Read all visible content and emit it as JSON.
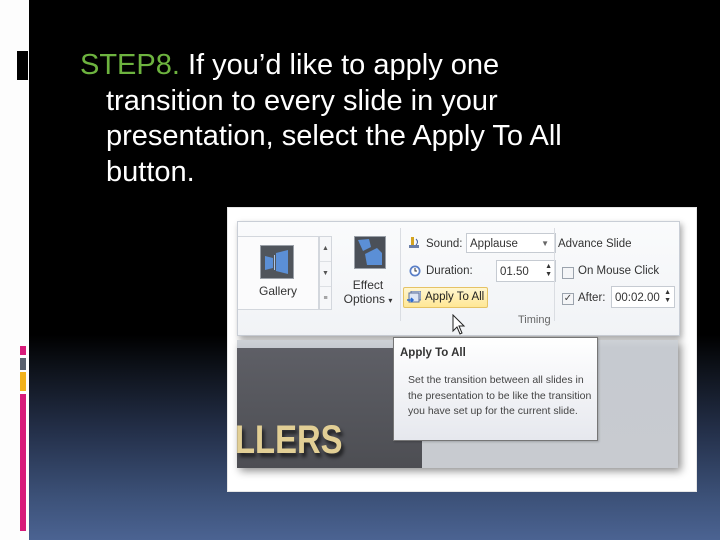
{
  "slide": {
    "title_step": "STEP8.",
    "title_lines": [
      "If you’d like to apply one",
      "transition to every slide in your",
      "presentation, select the Apply To All",
      "button."
    ],
    "accent_colors": {
      "step_text": "#6db33f",
      "magenta": "#d81b7a",
      "slate": "#59606e",
      "amber": "#f2b21b"
    }
  },
  "ribbon": {
    "gallery": {
      "label": "Gallery",
      "icon": "transition-gallery-icon"
    },
    "effect_options": {
      "label_line1": "Effect",
      "label_line2": "Options",
      "dropdown": "▾"
    },
    "sound": {
      "label": "Sound:",
      "value": "Applause",
      "icon": "speaker-icon"
    },
    "duration": {
      "label": "Duration:",
      "value": "01.50",
      "icon": "clock-icon"
    },
    "apply_to_all": {
      "label": "Apply To All",
      "icon": "apply-to-all-icon"
    },
    "timing_group_label": "Timing",
    "advance_slide": {
      "label": "Advance Slide",
      "on_mouse_click": {
        "label": "On Mouse Click",
        "checked": false
      },
      "after": {
        "label": "After:",
        "checked": true,
        "value": "00:02.00"
      }
    }
  },
  "preview": {
    "slide_text": "LLERS"
  },
  "tooltip": {
    "title": "Apply To All",
    "body": "Set the transition between all slides in the presentation to be like the transition you have set up for the current slide."
  }
}
